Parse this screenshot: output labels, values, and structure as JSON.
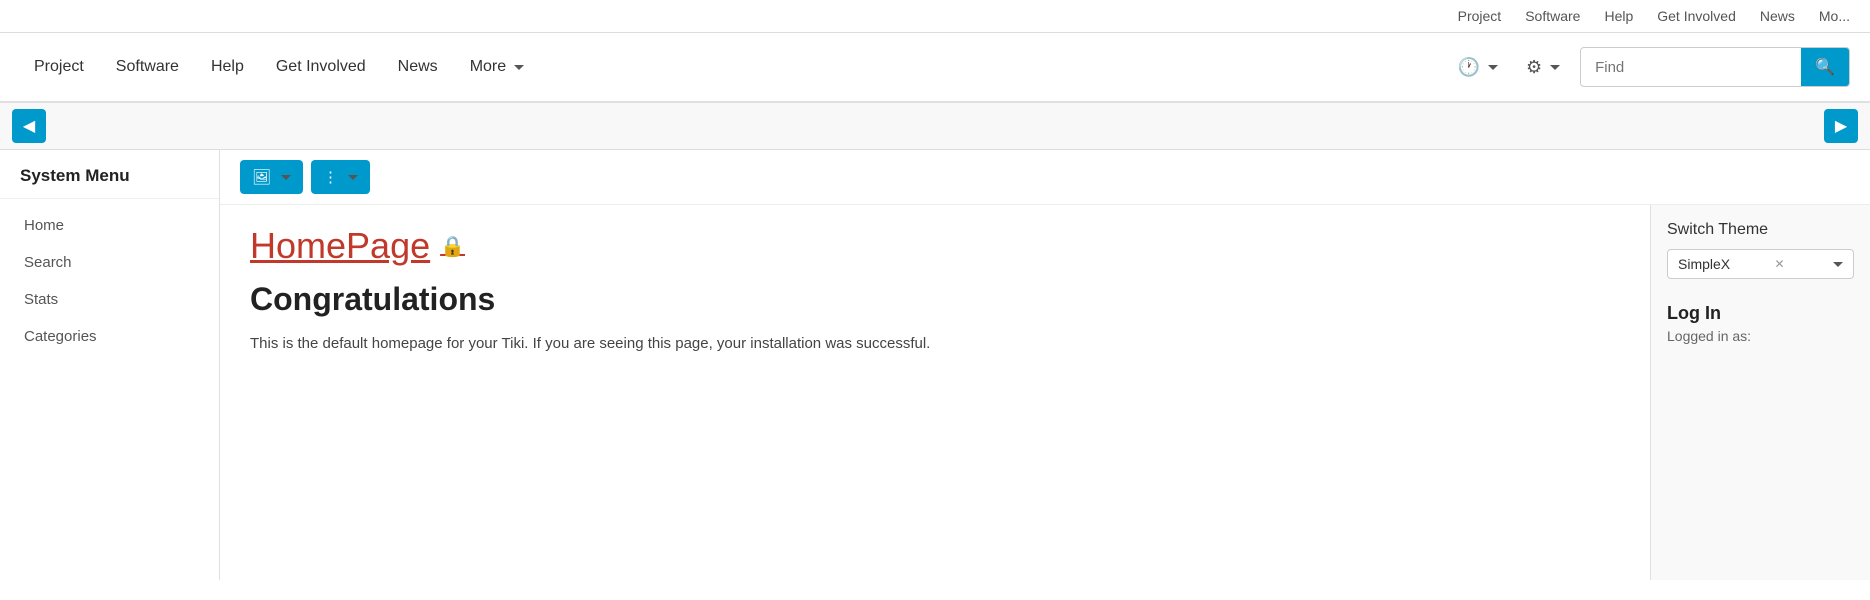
{
  "top_bar": {
    "links": [
      "Project",
      "Software",
      "Help",
      "Get Involved",
      "News",
      "Mo..."
    ]
  },
  "main_nav": {
    "links": [
      "Project",
      "Software",
      "Help",
      "Get Involved",
      "News"
    ],
    "more_label": "More",
    "find_placeholder": "Find",
    "search_label": "Search"
  },
  "sidebar": {
    "title": "System Menu",
    "items": [
      "Home",
      "Search",
      "Stats",
      "Categories"
    ]
  },
  "action_bar": {
    "btn1_label": "🖼",
    "btn2_label": "⋮"
  },
  "page": {
    "title": "HomePage",
    "lock_icon": "🔒",
    "congrats_title": "Congratulations",
    "congrats_text": "This is the default homepage for your Tiki. If you are seeing this page, your installation was successful."
  },
  "right_panel": {
    "switch_theme_label": "Switch Theme",
    "theme_value": "SimpleX",
    "log_in_label": "Log In",
    "logged_in_as_label": "Logged in as:"
  },
  "icons": {
    "clock": "🕐",
    "gear": "⚙",
    "search": "🔍",
    "lock": "🔒",
    "toggle_left": "◀",
    "toggle_right": "▶",
    "chevron_down": "▾"
  }
}
